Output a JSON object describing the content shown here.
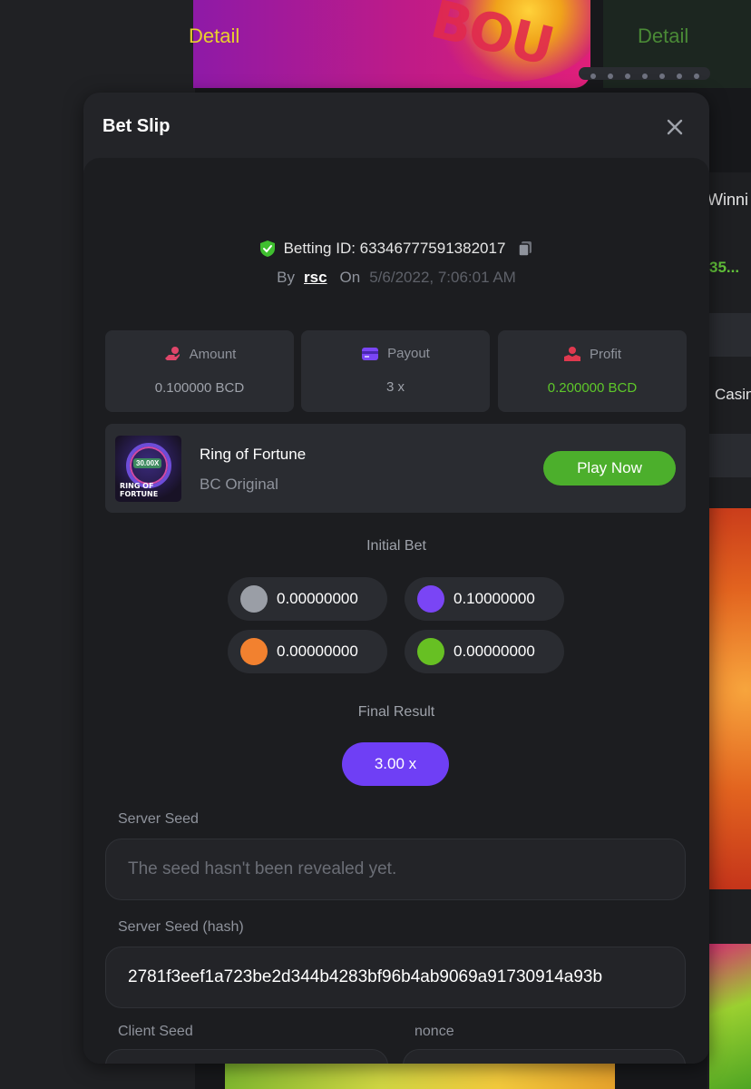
{
  "background": {
    "banner_detail_left": "Detail",
    "banner_detail_right": "Detail",
    "banner_brand": "BOU",
    "side_text_winning": "Winni",
    "side_number": "35...",
    "side_text_casino": "Casin"
  },
  "modal": {
    "title": "Bet Slip",
    "betting_id_label": "Betting ID: 63346777591382017",
    "by_label": "By",
    "user": "rsc",
    "on_label": "On",
    "date": "5/6/2022, 7:06:01 AM",
    "stats": [
      {
        "label": "Amount",
        "value": "0.100000 BCD",
        "icon": "amount-icon"
      },
      {
        "label": "Payout",
        "value": "3 x",
        "icon": "payout-icon"
      },
      {
        "label": "Profit",
        "value": "0.200000 BCD",
        "icon": "profit-icon"
      }
    ],
    "game": {
      "name": "Ring of Fortune",
      "provider": "BC Original",
      "play_label": "Play Now",
      "thumb_multiplier": "30.00X",
      "thumb_title_1": "RING OF",
      "thumb_title_2": "FORTUNE"
    },
    "initial_bet_label": "Initial Bet",
    "initial_bets": [
      {
        "color": "#9a9ea6",
        "amount": "0.00000000"
      },
      {
        "color": "#7a45f5",
        "amount": "0.10000000"
      },
      {
        "color": "#f2812f",
        "amount": "0.00000000"
      },
      {
        "color": "#67c023",
        "amount": "0.00000000"
      }
    ],
    "final_result_label": "Final Result",
    "final_result": "3.00 x",
    "server_seed_label": "Server Seed",
    "server_seed_placeholder": "The seed hasn't been revealed yet.",
    "server_seed_hash_label": "Server Seed (hash)",
    "server_seed_hash": "2781f3eef1a723be2d344b4283bf96b4ab9069a91730914a93b",
    "client_seed_label": "Client Seed",
    "nonce_label": "nonce"
  },
  "colors": {
    "accent_green": "#4caf2c",
    "profit_green": "#5ec72a",
    "result_purple": "#6f3ff5"
  }
}
